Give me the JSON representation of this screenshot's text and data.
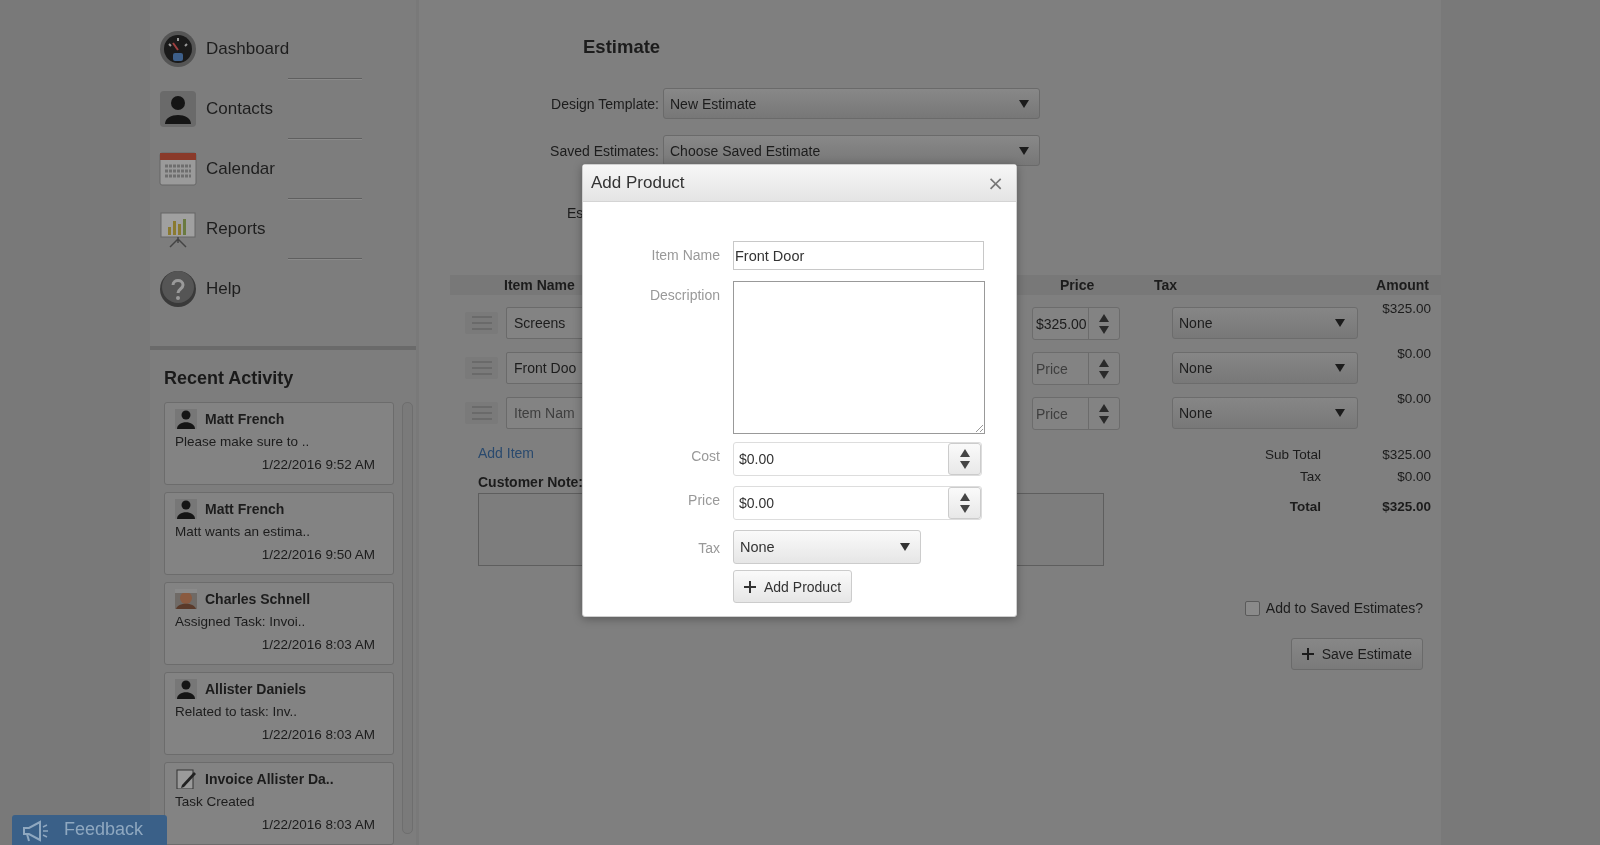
{
  "sidebar": {
    "nav": [
      {
        "kind": "gauge",
        "label": "Dashboard"
      },
      {
        "kind": "person",
        "label": "Contacts"
      },
      {
        "kind": "calendar",
        "label": "Calendar"
      },
      {
        "kind": "chart",
        "label": "Reports"
      },
      {
        "kind": "help",
        "label": "Help"
      }
    ],
    "recent_activity": {
      "title": "Recent Activity",
      "items": [
        {
          "kind": "person",
          "name": "Matt French",
          "text": "Please make sure to ..",
          "time": "1/22/2016 9:52 AM"
        },
        {
          "kind": "person",
          "name": "Matt French",
          "text": "Matt wants an estima..",
          "time": "1/22/2016 9:50 AM"
        },
        {
          "name": "Charles Schnell",
          "text": "Assigned Task: Invoi..",
          "time": "1/22/2016 8:03 AM"
        },
        {
          "kind": "person",
          "name": "Allister Daniels",
          "text": "Related to task: Inv..",
          "time": "1/22/2016 8:03 AM"
        },
        {
          "kind": "task",
          "name": "Invoice Allister Da..",
          "text": "Task Created",
          "time": "1/22/2016 8:03 AM"
        }
      ]
    }
  },
  "feedback": "Feedback",
  "estimate": {
    "title": "Estimate",
    "fields": [
      {
        "label": "Design Template:",
        "value": "New Estimate"
      },
      {
        "label": "Saved Estimates:",
        "value": "Choose Saved Estimate"
      }
    ],
    "partial_label": "Es",
    "table": {
      "columns": [
        "Item Name",
        "Price",
        "Tax",
        "Amount"
      ],
      "rows": [
        {
          "item": "Screens",
          "price": "$325.00",
          "tax": "None",
          "amount": "$325.00"
        },
        {
          "item": "Front Doo",
          "price_placeholder": "Price",
          "tax": "None",
          "amount": "$0.00"
        },
        {
          "item_placeholder": "Item Nam",
          "price_placeholder": "Price",
          "tax": "None",
          "amount": "$0.00"
        }
      ]
    },
    "add_item": "Add Item",
    "customer_note_label": "Customer Note:",
    "totals": [
      {
        "kind": "normal",
        "label": "Sub Total",
        "value": "$325.00"
      },
      {
        "kind": "normal",
        "label": "Tax",
        "value": "$0.00"
      },
      {
        "kind": "grand",
        "label": "Total",
        "value": "$325.00"
      }
    ],
    "save_to_list": {
      "label": "Add to Saved Estimates?",
      "checked": false
    },
    "save_button": "Save Estimate"
  },
  "dialog": {
    "title": "Add Product",
    "close": "×",
    "fields": [
      {
        "kind": "text",
        "label": "Item Name",
        "value": "Front Door"
      },
      {
        "kind": "textarea",
        "label": "Description"
      },
      {
        "kind": "number",
        "label": "Cost",
        "value": "$0.00"
      },
      {
        "kind": "number",
        "label": "Price",
        "value": "$0.00"
      },
      {
        "kind": "select",
        "label": "Tax",
        "value": "None"
      }
    ],
    "submit": "Add Product"
  }
}
